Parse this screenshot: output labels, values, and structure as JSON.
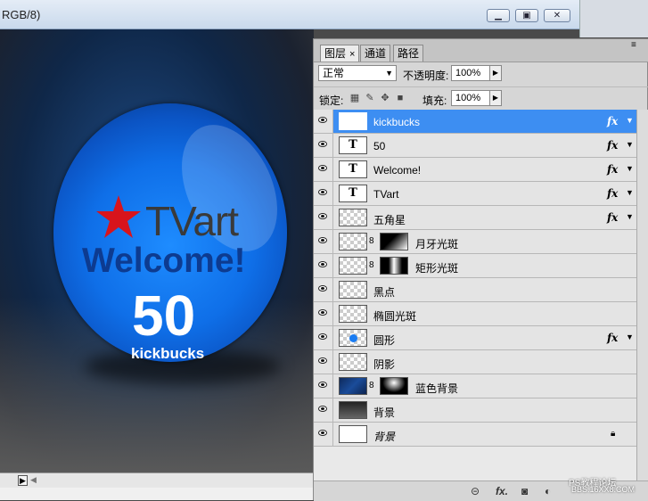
{
  "document": {
    "title_fragment": "RGB/8)",
    "minimize_icon": "minimize-icon",
    "restore_icon": "restore-icon",
    "close_icon": "close-icon"
  },
  "artwork": {
    "brand": "TVart",
    "welcome": "Welcome!",
    "number": "50",
    "currency": "kickbucks",
    "colors": {
      "ball": "#1276f0",
      "star": "#d8141c",
      "welcome": "#0d3b90",
      "brand": "#3a3a3a"
    }
  },
  "layers_panel": {
    "tabs": [
      {
        "label": "图层",
        "active": true
      },
      {
        "label": "通道",
        "active": false
      },
      {
        "label": "路径",
        "active": false
      }
    ],
    "blend_mode": "正常",
    "opacity_label": "不透明度:",
    "opacity_value": "100%",
    "lock_label": "锁定:",
    "fill_label": "填充:",
    "fill_value": "100%",
    "layers": [
      {
        "name": "kickbucks",
        "thumb": "text",
        "fx": true,
        "selected": true
      },
      {
        "name": "50",
        "thumb": "text",
        "fx": true
      },
      {
        "name": "Welcome!",
        "thumb": "text",
        "fx": true
      },
      {
        "name": "TVart",
        "thumb": "text",
        "fx": true
      },
      {
        "name": "五角星",
        "thumb": "checker",
        "fx": true
      },
      {
        "name": "月牙光斑",
        "thumb": "checker",
        "mask": true
      },
      {
        "name": "矩形光斑",
        "thumb": "checker",
        "mask": true
      },
      {
        "name": "黑点",
        "thumb": "checker"
      },
      {
        "name": "椭圆光斑",
        "thumb": "checker"
      },
      {
        "name": "圆形",
        "thumb": "checker",
        "fx": true
      },
      {
        "name": "阴影",
        "thumb": "checker"
      },
      {
        "name": "蓝色背景",
        "thumb": "blue",
        "mask": true
      },
      {
        "name": "背景",
        "thumb": "dark"
      },
      {
        "name": "背景",
        "thumb": "white",
        "locked": true,
        "italic": true
      }
    ],
    "text_thumb_glyph": "T",
    "fx_label": "fx"
  },
  "watermark": {
    "line1": "PS教程论坛",
    "line2": "BBS.16XX8.COM"
  }
}
